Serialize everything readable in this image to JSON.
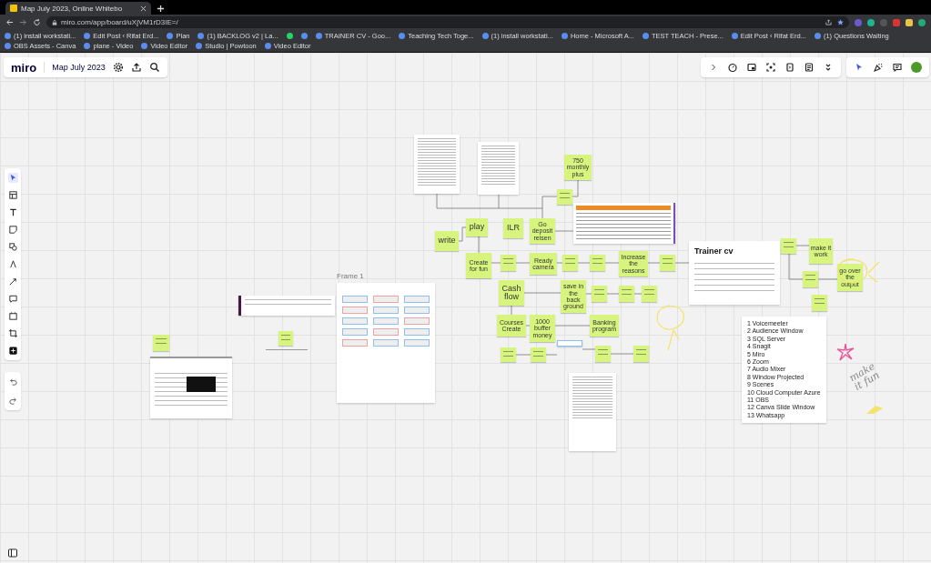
{
  "browser": {
    "tab_title": "Map July 2023, Online Whitebo",
    "url": "miro.com/app/board/uXjVM1rD3IE=/",
    "bookmarks": [
      "(1) install workstati...",
      "Edit Post ‹ Rifat Erd...",
      "Plan",
      "(1) BACKLOG v2 | La...",
      "TRAINER CV - Goo...",
      "Teaching Tech Toge...",
      "(1) install workstati...",
      "Home - Microsoft A...",
      "TEST TEACH - Prese...",
      "Edit Post ‹ Rifat Erd...",
      "(1) Questions Waiting",
      "OBS Assets - Canva",
      "plane - Video",
      "Video Editor",
      "Studio | Powtoon",
      "Video Editor"
    ]
  },
  "board": {
    "logo": "miro",
    "title": "Map July 2023"
  },
  "canvas": {
    "frame_label": "Frame 1",
    "stickies": [
      {
        "text": "write"
      },
      {
        "text": "play"
      },
      {
        "text": "ILR"
      },
      {
        "text": "Go deposit reisen"
      },
      {
        "text": "750 monthly plus"
      },
      {
        "text": "Create for fun"
      },
      {
        "text": "Ready camera"
      },
      {
        "text": "Cash flow"
      },
      {
        "text": "Courses Create"
      },
      {
        "text": "1000 buffer money"
      },
      {
        "text": "Banking program"
      },
      {
        "text": "save in the back ground"
      },
      {
        "text": "Increase the reasons"
      },
      {
        "text": "make it work"
      },
      {
        "text": "go over the output"
      }
    ],
    "card": {
      "title": "Trainer cv"
    },
    "list": [
      "1 Voicemeeter",
      "2 Audience Window",
      "3 SQL Server",
      "4 Snagit",
      "5 Miro",
      "6 Zoom",
      "7 Audio Mixer",
      "8 Window Projected",
      "9 Scenes",
      "10 Cloud Computer Azure",
      "11 OBS",
      "12 Canva Slide Window",
      "13 Whatsapp"
    ],
    "handwriting": "make it fun"
  }
}
